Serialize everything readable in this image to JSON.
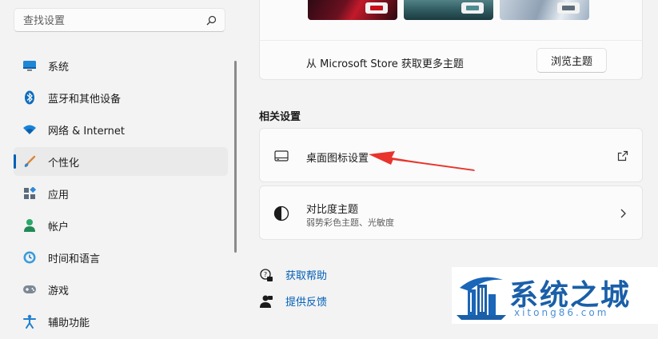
{
  "search": {
    "placeholder": "查找设置"
  },
  "sidebar": {
    "items": [
      {
        "label": "系统",
        "icon": "system-icon",
        "selected": false
      },
      {
        "label": "蓝牙和其他设备",
        "icon": "bluetooth-icon",
        "selected": false
      },
      {
        "label": "网络 & Internet",
        "icon": "wifi-icon",
        "selected": false
      },
      {
        "label": "个性化",
        "icon": "brush-icon",
        "selected": true
      },
      {
        "label": "应用",
        "icon": "apps-icon",
        "selected": false
      },
      {
        "label": "帐户",
        "icon": "account-icon",
        "selected": false
      },
      {
        "label": "时间和语言",
        "icon": "time-language-icon",
        "selected": false
      },
      {
        "label": "游戏",
        "icon": "gamepad-icon",
        "selected": false
      },
      {
        "label": "辅助功能",
        "icon": "accessibility-icon",
        "selected": false
      }
    ]
  },
  "themes": {
    "store_text": "从 Microsoft Store 获取更多主题",
    "browse_label": "浏览主题"
  },
  "related": {
    "title": "相关设置",
    "desktop_icons": {
      "title": "桌面图标设置"
    },
    "contrast": {
      "title": "对比度主题",
      "subtitle": "弱势彩色主题、光敏度"
    }
  },
  "help": {
    "get_help": "获取帮助",
    "feedback": "提供反馈"
  },
  "watermark": {
    "name": "系统之城",
    "url": "xitong86.com"
  },
  "colors": {
    "accent": "#005fb8",
    "arrow": "#e8342c",
    "watermark": "#1a5fa8"
  }
}
